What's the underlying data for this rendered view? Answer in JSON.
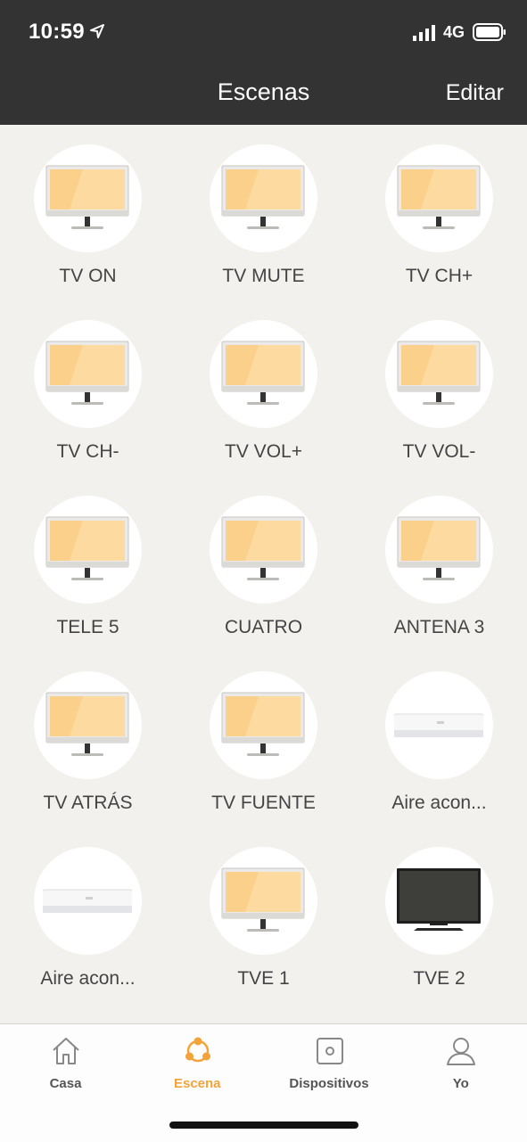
{
  "status": {
    "time": "10:59",
    "network": "4G"
  },
  "nav": {
    "title": "Escenas",
    "edit_label": "Editar"
  },
  "scenes": [
    {
      "label": "TV ON",
      "icon": "tv-icon"
    },
    {
      "label": "TV MUTE",
      "icon": "tv-icon"
    },
    {
      "label": "TV CH+",
      "icon": "tv-icon"
    },
    {
      "label": "TV CH-",
      "icon": "tv-icon"
    },
    {
      "label": "TV VOL+",
      "icon": "tv-icon"
    },
    {
      "label": "TV VOL-",
      "icon": "tv-icon"
    },
    {
      "label": "TELE 5",
      "icon": "tv-icon"
    },
    {
      "label": "CUATRO",
      "icon": "tv-icon"
    },
    {
      "label": "ANTENA 3",
      "icon": "tv-icon"
    },
    {
      "label": "TV ATRÁS",
      "icon": "tv-icon"
    },
    {
      "label": "TV FUENTE",
      "icon": "tv-icon"
    },
    {
      "label": "Aire acon...",
      "icon": "air-conditioner-icon"
    },
    {
      "label": "Aire acon...",
      "icon": "air-conditioner-icon"
    },
    {
      "label": "TVE 1",
      "icon": "tv-icon"
    },
    {
      "label": "TVE 2",
      "icon": "dark-tv-icon"
    }
  ],
  "tabs": [
    {
      "label": "Casa",
      "icon": "home-icon",
      "active": false
    },
    {
      "label": "Escena",
      "icon": "scene-icon",
      "active": true
    },
    {
      "label": "Dispositivos",
      "icon": "device-icon",
      "active": false
    },
    {
      "label": "Yo",
      "icon": "user-icon",
      "active": false
    }
  ],
  "colors": {
    "header": "#333333",
    "background": "#f3f1ee",
    "accent": "#f2a33a",
    "screen": "#fbd08a"
  }
}
